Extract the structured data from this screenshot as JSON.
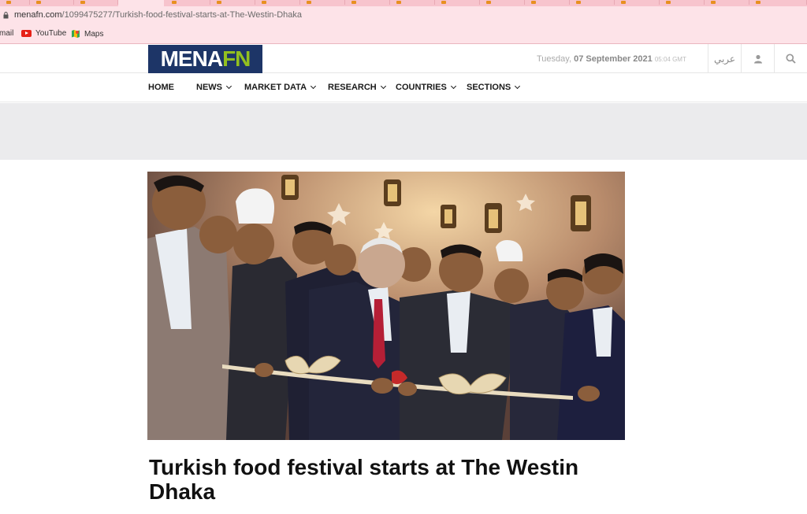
{
  "browser": {
    "url_host": "menafn.com",
    "url_path": "/1099475277/Turkish-food-festival-starts-at-The-Westin-Dhaka",
    "bookmarks": [
      {
        "label": "mail",
        "icon": "gmail-icon"
      },
      {
        "label": "YouTube",
        "icon": "youtube-icon"
      },
      {
        "label": "Maps",
        "icon": "maps-icon"
      }
    ]
  },
  "site": {
    "logo_left": "MENA",
    "logo_right": "FN",
    "date_day": "Tuesday,",
    "date_main": "07 September 2021",
    "date_time": "05:04 GMT",
    "arabic_label": "عربي",
    "nav": [
      {
        "label": "HOME",
        "dropdown": false
      },
      {
        "label": "NEWS",
        "dropdown": true
      },
      {
        "label": "MARKET DATA",
        "dropdown": true
      },
      {
        "label": "RESEARCH",
        "dropdown": true
      },
      {
        "label": "COUNTRIES",
        "dropdown": true
      },
      {
        "label": "SECTIONS",
        "dropdown": true
      }
    ]
  },
  "article": {
    "headline": "Turkish food festival starts at The Westin Dhaka",
    "image_alt": "ribbon-cutting-ceremony-photo"
  },
  "colors": {
    "brand_navy": "#1d3567",
    "brand_green": "#93c01f",
    "chrome_pink": "#fde3e8"
  }
}
